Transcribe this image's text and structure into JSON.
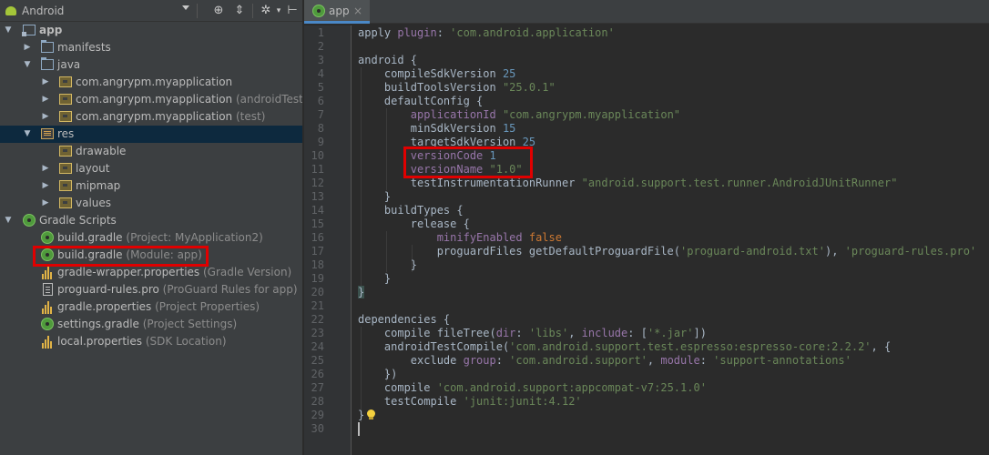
{
  "project_pane": {
    "view_selector": "Android",
    "tree": [
      {
        "label": "app",
        "hint": ""
      },
      {
        "label": "manifests",
        "hint": ""
      },
      {
        "label": "java",
        "hint": ""
      },
      {
        "label": "com.angrypm.myapplication",
        "hint": ""
      },
      {
        "label": "com.angrypm.myapplication",
        "hint": "(androidTest)"
      },
      {
        "label": "com.angrypm.myapplication",
        "hint": "(test)"
      },
      {
        "label": "res",
        "hint": ""
      },
      {
        "label": "drawable",
        "hint": ""
      },
      {
        "label": "layout",
        "hint": ""
      },
      {
        "label": "mipmap",
        "hint": ""
      },
      {
        "label": "values",
        "hint": ""
      },
      {
        "label": "Gradle Scripts",
        "hint": ""
      },
      {
        "label": "build.gradle",
        "hint": "(Project: MyApplication2)"
      },
      {
        "label": "build.gradle",
        "hint": "(Module: app)"
      },
      {
        "label": "gradle-wrapper.properties",
        "hint": "(Gradle Version)"
      },
      {
        "label": "proguard-rules.pro",
        "hint": "(ProGuard Rules for app)"
      },
      {
        "label": "gradle.properties",
        "hint": "(Project Properties)"
      },
      {
        "label": "settings.gradle",
        "hint": "(Project Settings)"
      },
      {
        "label": "local.properties",
        "hint": "(SDK Location)"
      }
    ]
  },
  "editor": {
    "tab_label": "app",
    "tab_close": "×",
    "line_numbers": [
      "1",
      "2",
      "3",
      "4",
      "5",
      "6",
      "7",
      "8",
      "9",
      "10",
      "11",
      "12",
      "13",
      "14",
      "15",
      "16",
      "17",
      "18",
      "19",
      "20",
      "21",
      "22",
      "23",
      "24",
      "25",
      "26",
      "27",
      "28",
      "29",
      "30"
    ],
    "code": {
      "l1_a": "apply ",
      "l1_b": "plugin",
      "l1_c": ": ",
      "l1_d": "'com.android.application'",
      "l3": "android {",
      "l4_a": "    compileSdkVersion ",
      "l4_b": "25",
      "l5_a": "    buildToolsVersion ",
      "l5_b": "\"25.0.1\"",
      "l6": "    defaultConfig {",
      "l7_a": "        applicationId ",
      "l7_b": "\"com.angrypm.myapplication\"",
      "l8_a": "        minSdkVersion ",
      "l8_b": "15",
      "l9_a": "        targetSdkVersion ",
      "l9_b": "25",
      "l10_a": "        versionCode ",
      "l10_b": "1",
      "l11_a": "        versionName ",
      "l11_b": "\"1.0\"",
      "l12_a": "        testInstrumentationRunner ",
      "l12_b": "\"android.support.test.runner.AndroidJUnitRunner\"",
      "l13": "    }",
      "l14": "    buildTypes {",
      "l15": "        release {",
      "l16_a": "            minifyEnabled ",
      "l16_b": "false",
      "l17_a": "            proguardFiles getDefaultProguardFile(",
      "l17_b": "'proguard-android.txt'",
      "l17_c": "), ",
      "l17_d": "'proguard-rules.pro'",
      "l18": "        }",
      "l19": "    }",
      "l20": "}",
      "l22": "dependencies {",
      "l23_a": "    compile fileTree(",
      "l23_b": "dir",
      "l23_c": ": ",
      "l23_d": "'libs'",
      "l23_e": ", ",
      "l23_f": "include",
      "l23_g": ": [",
      "l23_h": "'*.jar'",
      "l23_i": "])",
      "l24_a": "    androidTestCompile(",
      "l24_b": "'com.android.support.test.espresso:espresso-core:2.2.2'",
      "l24_c": ", {",
      "l25_a": "        exclude ",
      "l25_b": "group",
      "l25_c": ": ",
      "l25_d": "'com.android.support'",
      "l25_e": ", ",
      "l25_f": "module",
      "l25_g": ": ",
      "l25_h": "'support-annotations'",
      "l26": "    })",
      "l27_a": "    compile ",
      "l27_b": "'com.android.support:appcompat-v7:25.1.0'",
      "l28_a": "    testCompile ",
      "l28_b": "'junit:junit:4.12'",
      "l29": "}"
    }
  },
  "colors": {
    "highlight_border": "#e00000",
    "keyword": "#cc7832",
    "string": "#6a8759",
    "number": "#6897bb",
    "property": "#9876aa"
  }
}
